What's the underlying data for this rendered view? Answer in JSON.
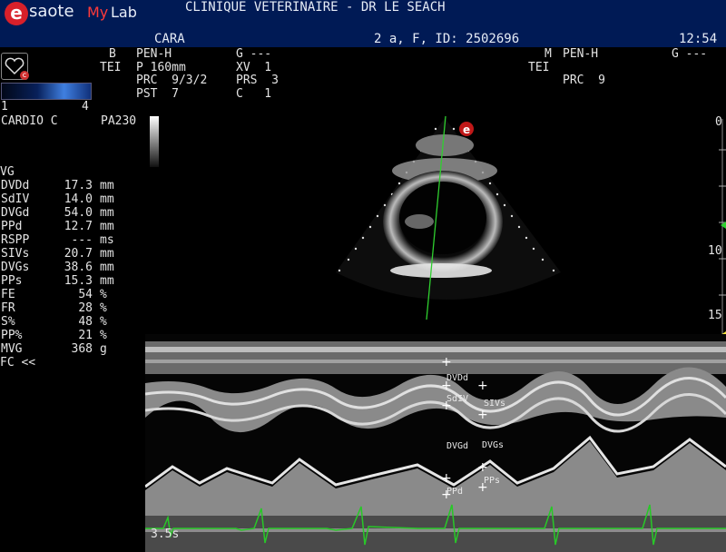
{
  "header": {
    "brand_e": "e",
    "brand_rest": "saote",
    "brand_my": "My",
    "brand_lab": "Lab",
    "clinic": "CLINIQUE VETERINAIRE - DR LE SEACH",
    "patient_name": "CARA",
    "patient_info": "2 a, F, ID: 2502696",
    "time": "12:54"
  },
  "params_b": {
    "mode": "B",
    "probe": "PEN-H",
    "g": "G ---",
    "tei": "TEI",
    "p": "P 160mm",
    "xv": "XV  1",
    "prc": "PRC  9/3/2",
    "prs": "PRS  3",
    "pst": "PST  7",
    "c": "C   1"
  },
  "params_m": {
    "mode": "M",
    "probe": "PEN-H",
    "g": "G ---",
    "tei": "TEI",
    "prc": "PRC  9"
  },
  "left_panel": {
    "heart_badge": "c",
    "range_min": "1",
    "range_max": "4",
    "preset": "CARDIO C",
    "probe_model": "PA230"
  },
  "measurements": {
    "title": "VG",
    "rows": [
      {
        "label": "DVDd",
        "value": "17.3",
        "unit": "mm"
      },
      {
        "label": "SdIV",
        "value": "14.0",
        "unit": "mm"
      },
      {
        "label": "DVGd",
        "value": "54.0",
        "unit": "mm"
      },
      {
        "label": "PPd",
        "value": "12.7",
        "unit": "mm"
      },
      {
        "label": "RSPP",
        "value": "---",
        "unit": "ms"
      },
      {
        "label": "SIVs",
        "value": "20.7",
        "unit": "mm"
      },
      {
        "label": "DVGs",
        "value": "38.6",
        "unit": "mm"
      },
      {
        "label": "PPs",
        "value": "15.3",
        "unit": "mm"
      },
      {
        "label": "FE",
        "value": "54",
        "unit": "%"
      },
      {
        "label": "FR",
        "value": "28",
        "unit": "%"
      },
      {
        "label": "S%",
        "value": "48",
        "unit": "%"
      },
      {
        "label": "PP%",
        "value": "21",
        "unit": "%"
      },
      {
        "label": "MVG",
        "value": "368",
        "unit": "g"
      }
    ],
    "fc": "FC <<"
  },
  "depth_scale": {
    "top": "0",
    "mid": "10",
    "bottom": "15"
  },
  "calipers": {
    "dvdd": "DVDd",
    "sdiv": "SdIV",
    "sivs": "SIVs",
    "dvgd": "DVGd",
    "dvgs": "DVGs",
    "pps": "PPs",
    "ppd": "PPd"
  },
  "sweep_label": "3.5s",
  "colors": {
    "header_bg": "#001a55",
    "ecg": "#28c828",
    "measure_title": "#f2e23a",
    "logo_red": "#d8202a"
  }
}
